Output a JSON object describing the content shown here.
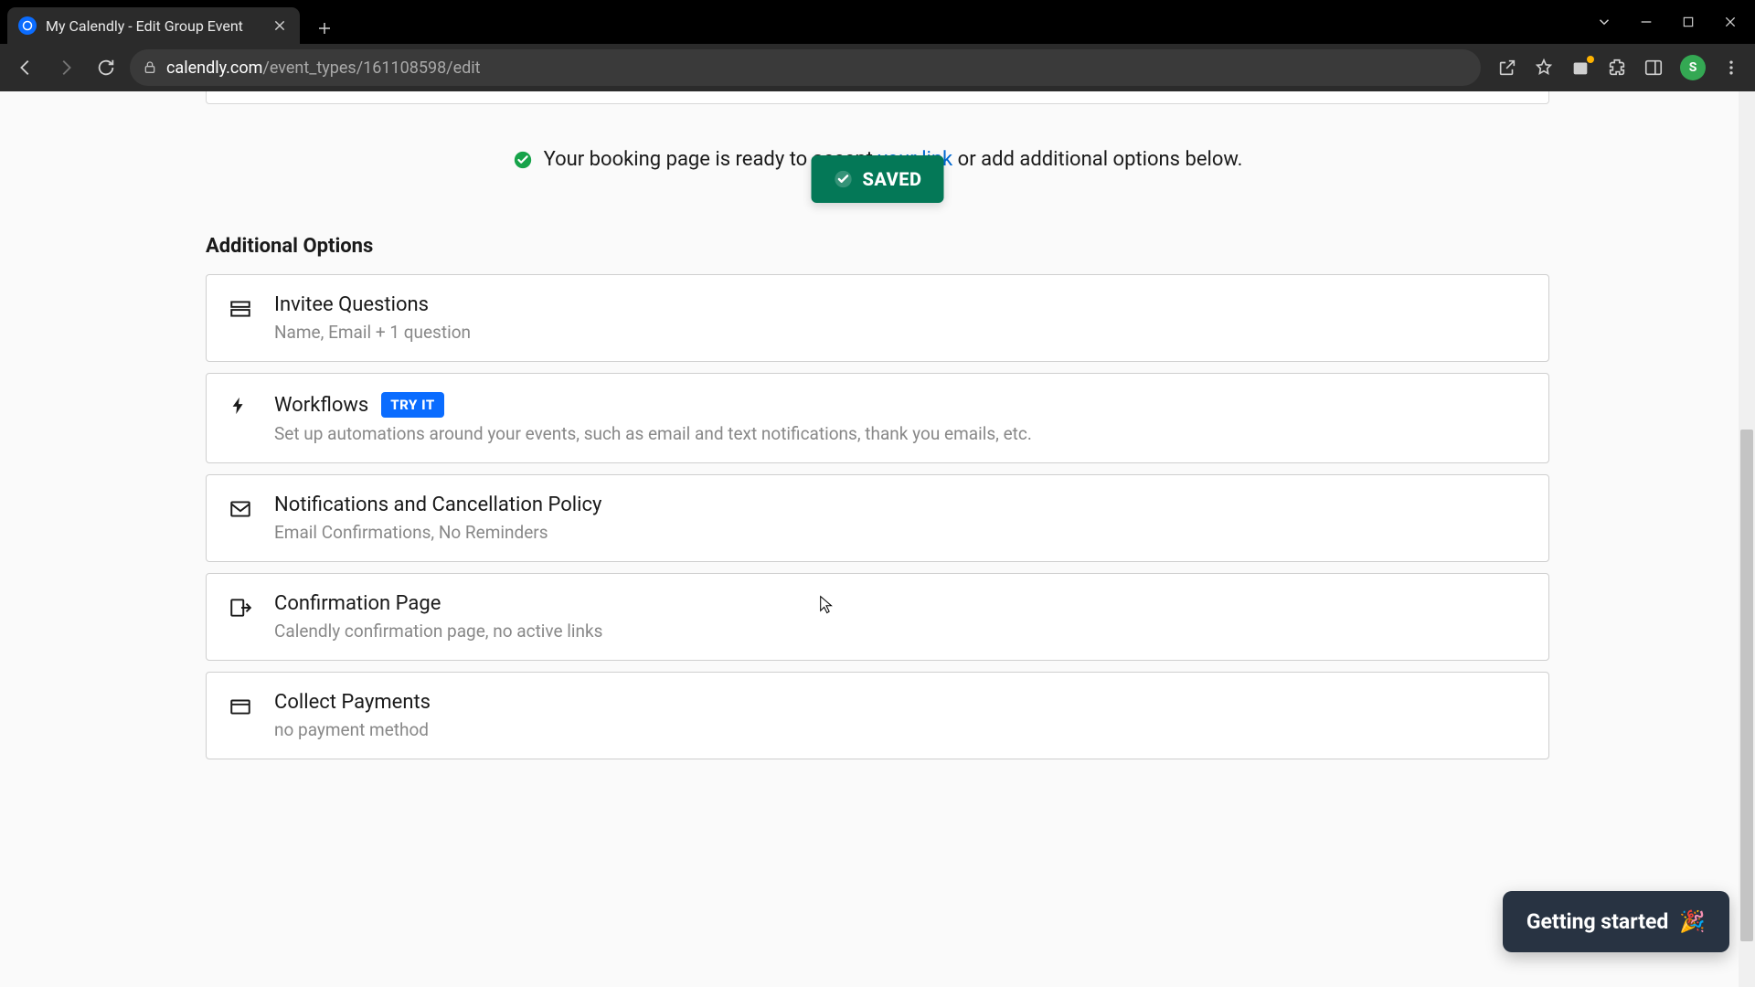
{
  "browser": {
    "tab_title": "My Calendly - Edit Group Event",
    "url_domain": "calendly.com",
    "url_path": "/event_types/161108598/edit",
    "avatar_initial": "S"
  },
  "toast": {
    "label": "SAVED"
  },
  "ready": {
    "prefix": "Your booking page is ready to accept ",
    "link": "your link",
    "suffix": " or add additional options below."
  },
  "section_title": "Additional Options",
  "options": [
    {
      "icon": "stack",
      "title": "Invitee Questions",
      "sub": "Name, Email + 1 question",
      "badge": null
    },
    {
      "icon": "bolt",
      "title": "Workflows",
      "sub": "Set up automations around your events, such as email and text notifications, thank you emails, etc.",
      "badge": "TRY IT"
    },
    {
      "icon": "mail",
      "title": "Notifications and Cancellation Policy",
      "sub": "Email Confirmations, No Reminders",
      "badge": null
    },
    {
      "icon": "exit",
      "title": "Confirmation Page",
      "sub": "Calendly confirmation page, no active links",
      "badge": null
    },
    {
      "icon": "card",
      "title": "Collect Payments",
      "sub": "no payment method",
      "badge": null
    }
  ],
  "help": {
    "label": "Getting started",
    "emoji": "🎉"
  }
}
